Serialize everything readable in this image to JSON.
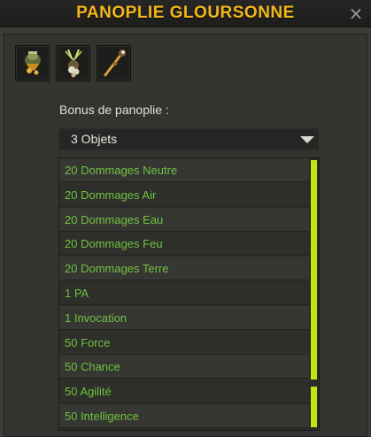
{
  "window": {
    "title": "PANOPLIE GLOURSONNE",
    "close_glyph": "×",
    "title_color": "#f3b61d"
  },
  "items": [
    {
      "icon": "gloursonne-hat-icon"
    },
    {
      "icon": "gloursonne-amulet-icon"
    },
    {
      "icon": "gloursonne-staff-icon"
    }
  ],
  "bonus": {
    "label": "Bonus de panoplie :",
    "selected": "3 Objets"
  },
  "bonus_list": [
    "20 Dommages Neutre",
    "20 Dommages Air",
    "20 Dommages Eau",
    "20 Dommages Feu",
    "20 Dommages Terre",
    "1 PA",
    "1 Invocation",
    "50 Force",
    "50 Chance",
    "50 Agilité",
    "50 Intelligence"
  ],
  "colors": {
    "bonus_text": "#6fc33f",
    "scrollbar": "#c4e214"
  }
}
